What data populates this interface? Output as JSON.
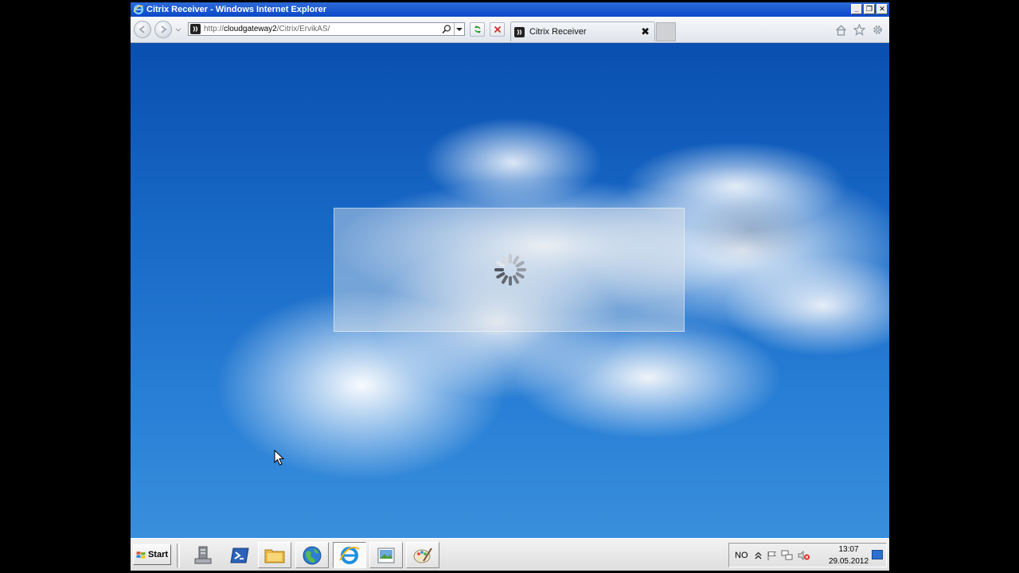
{
  "window": {
    "title": "Citrix Receiver - Windows Internet Explorer",
    "minimize_label": "_",
    "maximize_label": "❐",
    "close_label": "✕"
  },
  "address_bar": {
    "url_prefix": "http://",
    "url_host": "cloudgateway2",
    "url_path": "/Citrix/ErvikAS/"
  },
  "tab": {
    "label": "Citrix Receiver",
    "close_label": "✖"
  },
  "taskbar": {
    "start_label": "Start",
    "language": "NO",
    "time": "13:07",
    "date": "29.05.2012"
  },
  "colors": {
    "titlebar": "#0a48c8",
    "sky": "#1767c5"
  },
  "icons": {
    "back": "back-arrow-icon",
    "forward": "forward-arrow-icon",
    "refresh": "refresh-icon",
    "stop": "stop-icon",
    "home": "home-icon",
    "favorites": "star-icon",
    "tools": "gear-icon"
  }
}
